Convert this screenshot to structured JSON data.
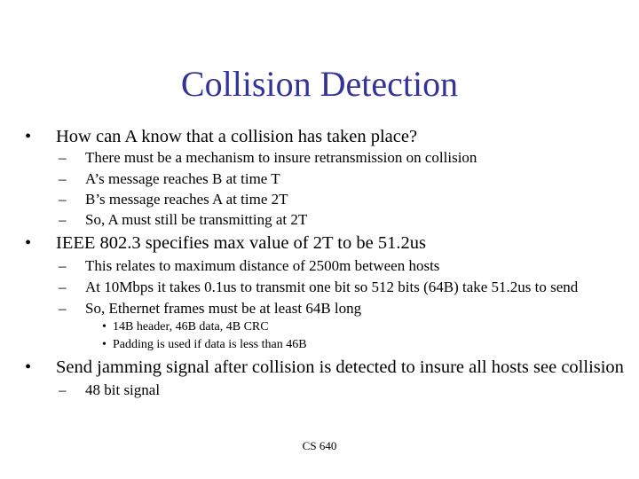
{
  "slide": {
    "title": "Collision Detection",
    "footer": "CS 640",
    "bullets": [
      {
        "text": "How can A know that a collision has taken place?",
        "sub": [
          "There must be a mechanism to insure retransmission on collision",
          "A’s message reaches B at time T",
          "B’s message reaches A at time 2T",
          "So, A must still be transmitting at 2T"
        ]
      },
      {
        "text": "IEEE 802.3 specifies max value of 2T to be 51.2us",
        "sub": [
          "This relates to maximum distance of 2500m between hosts",
          "At 10Mbps it takes 0.1us to transmit one bit so 512 bits (64B) take 51.2us to send",
          "So, Ethernet frames must be at least 64B long"
        ],
        "subsub": [
          "14B header, 46B data, 4B CRC",
          "Padding is used if data is less than 46B"
        ]
      },
      {
        "text": "Send jamming signal after collision is detected to insure all hosts see collision",
        "sub": [
          "48 bit signal"
        ]
      }
    ],
    "markers": {
      "bullet": "•",
      "dash": "–",
      "small_bullet": "•"
    },
    "colors": {
      "title": "#333399",
      "text": "#000000"
    }
  }
}
